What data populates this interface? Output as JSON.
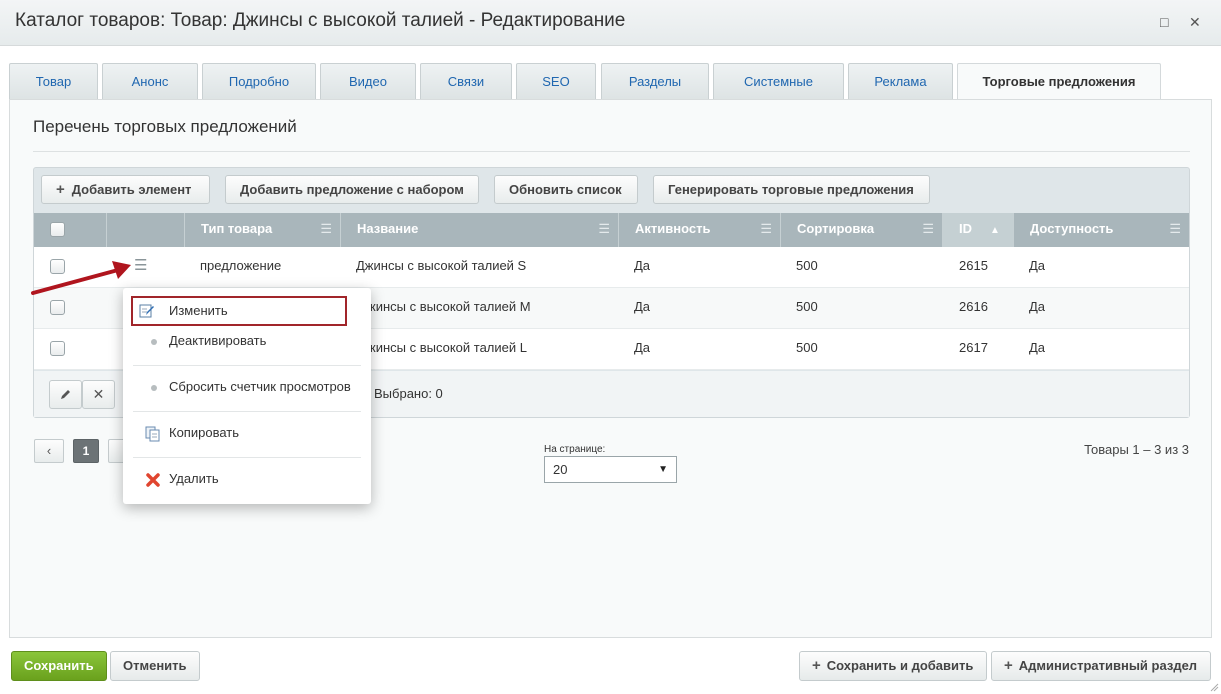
{
  "window": {
    "title": "Каталог товаров: Товар: Джинсы с высокой талией - Редактирование",
    "maximize_icon": "□",
    "close_icon": "✕"
  },
  "tabs": [
    {
      "label": "Товар"
    },
    {
      "label": "Анонс"
    },
    {
      "label": "Подробно"
    },
    {
      "label": "Видео"
    },
    {
      "label": "Связи"
    },
    {
      "label": "SEO"
    },
    {
      "label": "Разделы"
    },
    {
      "label": "Системные"
    },
    {
      "label": "Реклама"
    },
    {
      "label": "Торговые предложения"
    }
  ],
  "active_tab": "Торговые предложения",
  "section": {
    "title": "Перечень торговых предложений"
  },
  "toolbar": {
    "add_element": "Добавить элемент",
    "add_offer_set": "Добавить предложение с набором",
    "refresh_list": "Обновить список",
    "generate_offers": "Генерировать торговые предложения"
  },
  "table": {
    "columns": [
      "Тип товара",
      "Название",
      "Активность",
      "Сортировка",
      "ID",
      "Доступность"
    ],
    "sort_column": "ID",
    "sort_direction": "asc",
    "rows": [
      {
        "type": "предложение",
        "name": "Джинсы с высокой талией S",
        "active": "Да",
        "sort": "500",
        "id": "2615",
        "available": "Да"
      },
      {
        "type": "",
        "name": "жинсы с высокой талией M",
        "active": "Да",
        "sort": "500",
        "id": "2616",
        "available": "Да"
      },
      {
        "type": "",
        "name": "жинсы с высокой талией L",
        "active": "Да",
        "sort": "500",
        "id": "2617",
        "available": "Да"
      }
    ],
    "selected_label": "Выбрано: 0"
  },
  "context_menu": {
    "items": [
      {
        "label": "Изменить",
        "icon": "edit-icon",
        "highlighted": true
      },
      {
        "label": "Деактивировать",
        "icon": "dot-icon"
      },
      {
        "label": "Сбросить счетчик просмотров",
        "icon": "dot-icon"
      },
      {
        "label": "Копировать",
        "icon": "copy-icon"
      },
      {
        "label": "Удалить",
        "icon": "delete-icon"
      }
    ]
  },
  "pagination": {
    "prev": "‹",
    "current_page": "1",
    "per_page_label": "На странице:",
    "per_page_value": "20",
    "total": "Товары 1 – 3 из 3"
  },
  "footer": {
    "save": "Сохранить",
    "cancel": "Отменить",
    "save_and_add": "Сохранить и добавить",
    "admin_section": "Административный раздел"
  },
  "colors": {
    "save_green": "#78b02a",
    "header_gray": "#a9b6bb",
    "highlight_border": "#a1252a",
    "arrow_red": "#b0151e"
  }
}
